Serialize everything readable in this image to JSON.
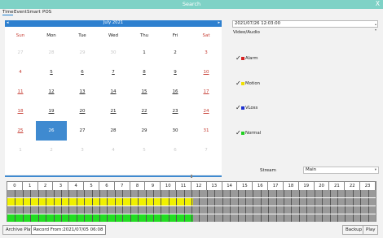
{
  "window": {
    "title": "Search",
    "close_glyph": "X"
  },
  "tabs": [
    {
      "label": "Time",
      "active": true
    },
    {
      "label": "Event",
      "active": false
    },
    {
      "label": "Smart",
      "active": false
    },
    {
      "label": "POS",
      "active": false
    }
  ],
  "calendar": {
    "month_label": "July  2021",
    "prev_glyph": "◂",
    "next_glyph": "▸",
    "weekdays": [
      "Sun",
      "Mon",
      "Tue",
      "Wed",
      "Thu",
      "Fri",
      "Sat"
    ],
    "weeks": [
      [
        "27",
        "28",
        "29",
        "30",
        "1",
        "2",
        "3"
      ],
      [
        "4",
        "5",
        "6",
        "7",
        "8",
        "9",
        "10"
      ],
      [
        "11",
        "12",
        "13",
        "14",
        "15",
        "16",
        "17"
      ],
      [
        "18",
        "19",
        "20",
        "21",
        "22",
        "23",
        "24"
      ],
      [
        "25",
        "26",
        "27",
        "28",
        "29",
        "30",
        "31"
      ],
      [
        "1",
        "2",
        "3",
        "4",
        "5",
        "6",
        "7"
      ]
    ],
    "selected_day": "26",
    "days_with_records": [
      "5",
      "6",
      "7",
      "8",
      "9",
      "10",
      "11",
      "12",
      "13",
      "14",
      "15",
      "16",
      "17",
      "18",
      "19",
      "20",
      "21",
      "22",
      "23",
      "24",
      "25"
    ]
  },
  "datetime": {
    "value": "2021/07/26 12:03:00"
  },
  "video_audio": {
    "label": "Video/Audio",
    "types": [
      {
        "label": "Alarm",
        "color": "#d62020",
        "checked": true
      },
      {
        "label": "Motion",
        "color": "#f0e000",
        "checked": true
      },
      {
        "label": "VLoss",
        "color": "#1a2fd0",
        "checked": true
      },
      {
        "label": "Normal",
        "color": "#20d020",
        "checked": true
      }
    ]
  },
  "stream": {
    "label": "Stream",
    "value": "Main"
  },
  "timeline": {
    "hours": [
      "0",
      "1",
      "2",
      "3",
      "4",
      "5",
      "6",
      "7",
      "8",
      "9",
      "10",
      "11",
      "12",
      "13",
      "14",
      "15",
      "16",
      "17",
      "18",
      "19",
      "20",
      "21",
      "22",
      "23"
    ],
    "channels": [
      {
        "color": "#9a9a9a",
        "record_hours": 0
      },
      {
        "color": "#f0f000",
        "record_hours": 12.1
      },
      {
        "color": "#9a9a9a",
        "record_hours": 0
      },
      {
        "color": "#22dd22",
        "record_hours": 12.1
      }
    ],
    "base_color": "#9a9a9a"
  },
  "bottom": {
    "archive_play_label": "Archive Play",
    "record_from": "Record From:2021/07/05 06:08",
    "backup_label": "Backup",
    "play_label": "Play"
  }
}
